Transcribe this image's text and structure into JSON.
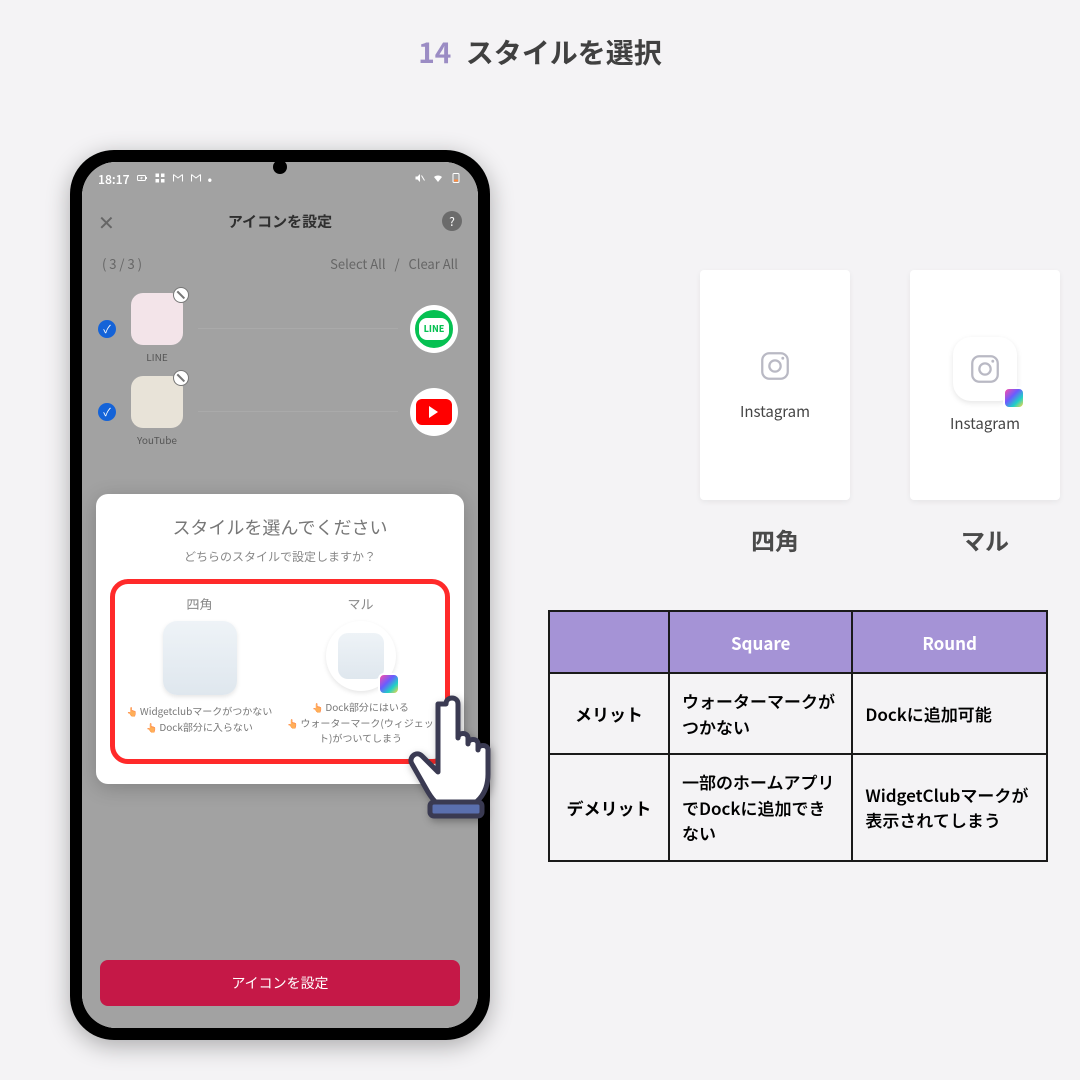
{
  "page": {
    "step_num": "14",
    "title": "スタイルを選択"
  },
  "phone": {
    "status": {
      "time": "18:17"
    },
    "header": {
      "title": "アイコンを設定",
      "close": "✕",
      "help": "?"
    },
    "count_row": {
      "count": "( 3 / 3 )",
      "select_all": "Select All",
      "clear_all": "Clear All",
      "separator": "/"
    },
    "rows": [
      {
        "label": "LINE",
        "target": "LINE"
      },
      {
        "label": "YouTube",
        "target": "YouTube"
      }
    ],
    "modal": {
      "title": "スタイルを選んでください",
      "subtitle": "どちらのスタイルで設定しますか？",
      "square": {
        "label": "四角",
        "bullet1": "Widgetclubマークがつかない",
        "bullet2": "Dock部分に入らない"
      },
      "round": {
        "label": "マル",
        "bullet1": "Dock部分にはいる",
        "bullet2": "ウォーターマーク(ウィジェット)がついてしまう"
      }
    },
    "cta": "アイコンを設定"
  },
  "examples": {
    "label": "Instagram",
    "square_label": "四角",
    "round_label": "マル"
  },
  "table": {
    "head": {
      "c1": "",
      "c2": "Square",
      "c3": "Round"
    },
    "rows": [
      {
        "label": "メリット",
        "square": "ウォーターマークがつかない",
        "round": "Dockに追加可能"
      },
      {
        "label": "デメリット",
        "square": "一部のホームアプリでDockに追加できない",
        "round": "WidgetClubマークが表示されてしまう"
      }
    ]
  }
}
